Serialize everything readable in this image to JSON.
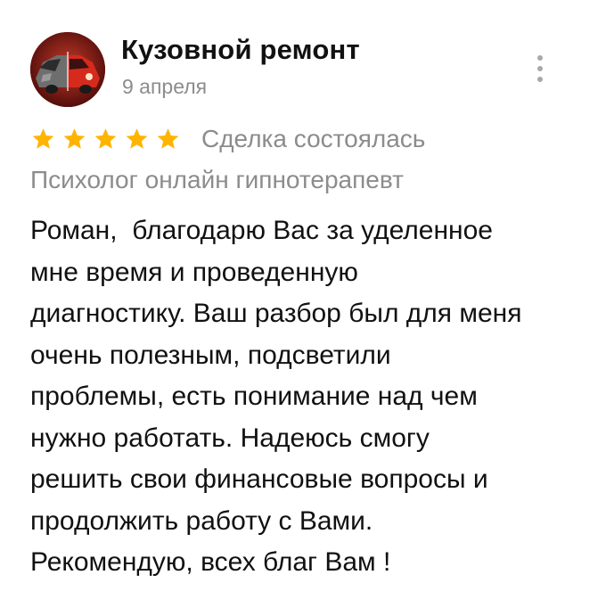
{
  "review": {
    "author": {
      "name": "Кузовной ремонт",
      "avatar_icon": "car-repair-avatar-icon"
    },
    "date": "9 апреля",
    "more_icon": "more-vertical-icon",
    "rating": {
      "stars": 5,
      "max": 5,
      "star_color": "#FFB400"
    },
    "deal_status": "Сделка состоялась",
    "service": "Психолог онлайн гипнотерапевт",
    "text_lines": [
      "Роман,  благодарю Вас за уделенное",
      "мне время и проведенную",
      "диагностику. Ваш разбор был для меня",
      "очень полезным, подсветили",
      "проблемы, есть понимание над чем",
      "нужно работать. Надеюсь смогу",
      "решить свои финансовые вопросы и",
      "продолжить работу с Вами.",
      "Рекомендую, всех благ Вам !"
    ]
  },
  "colors": {
    "primary_text": "#111111",
    "secondary_text": "#8C8C8C",
    "star": "#FFB400",
    "dots": "#A8A8A8"
  }
}
